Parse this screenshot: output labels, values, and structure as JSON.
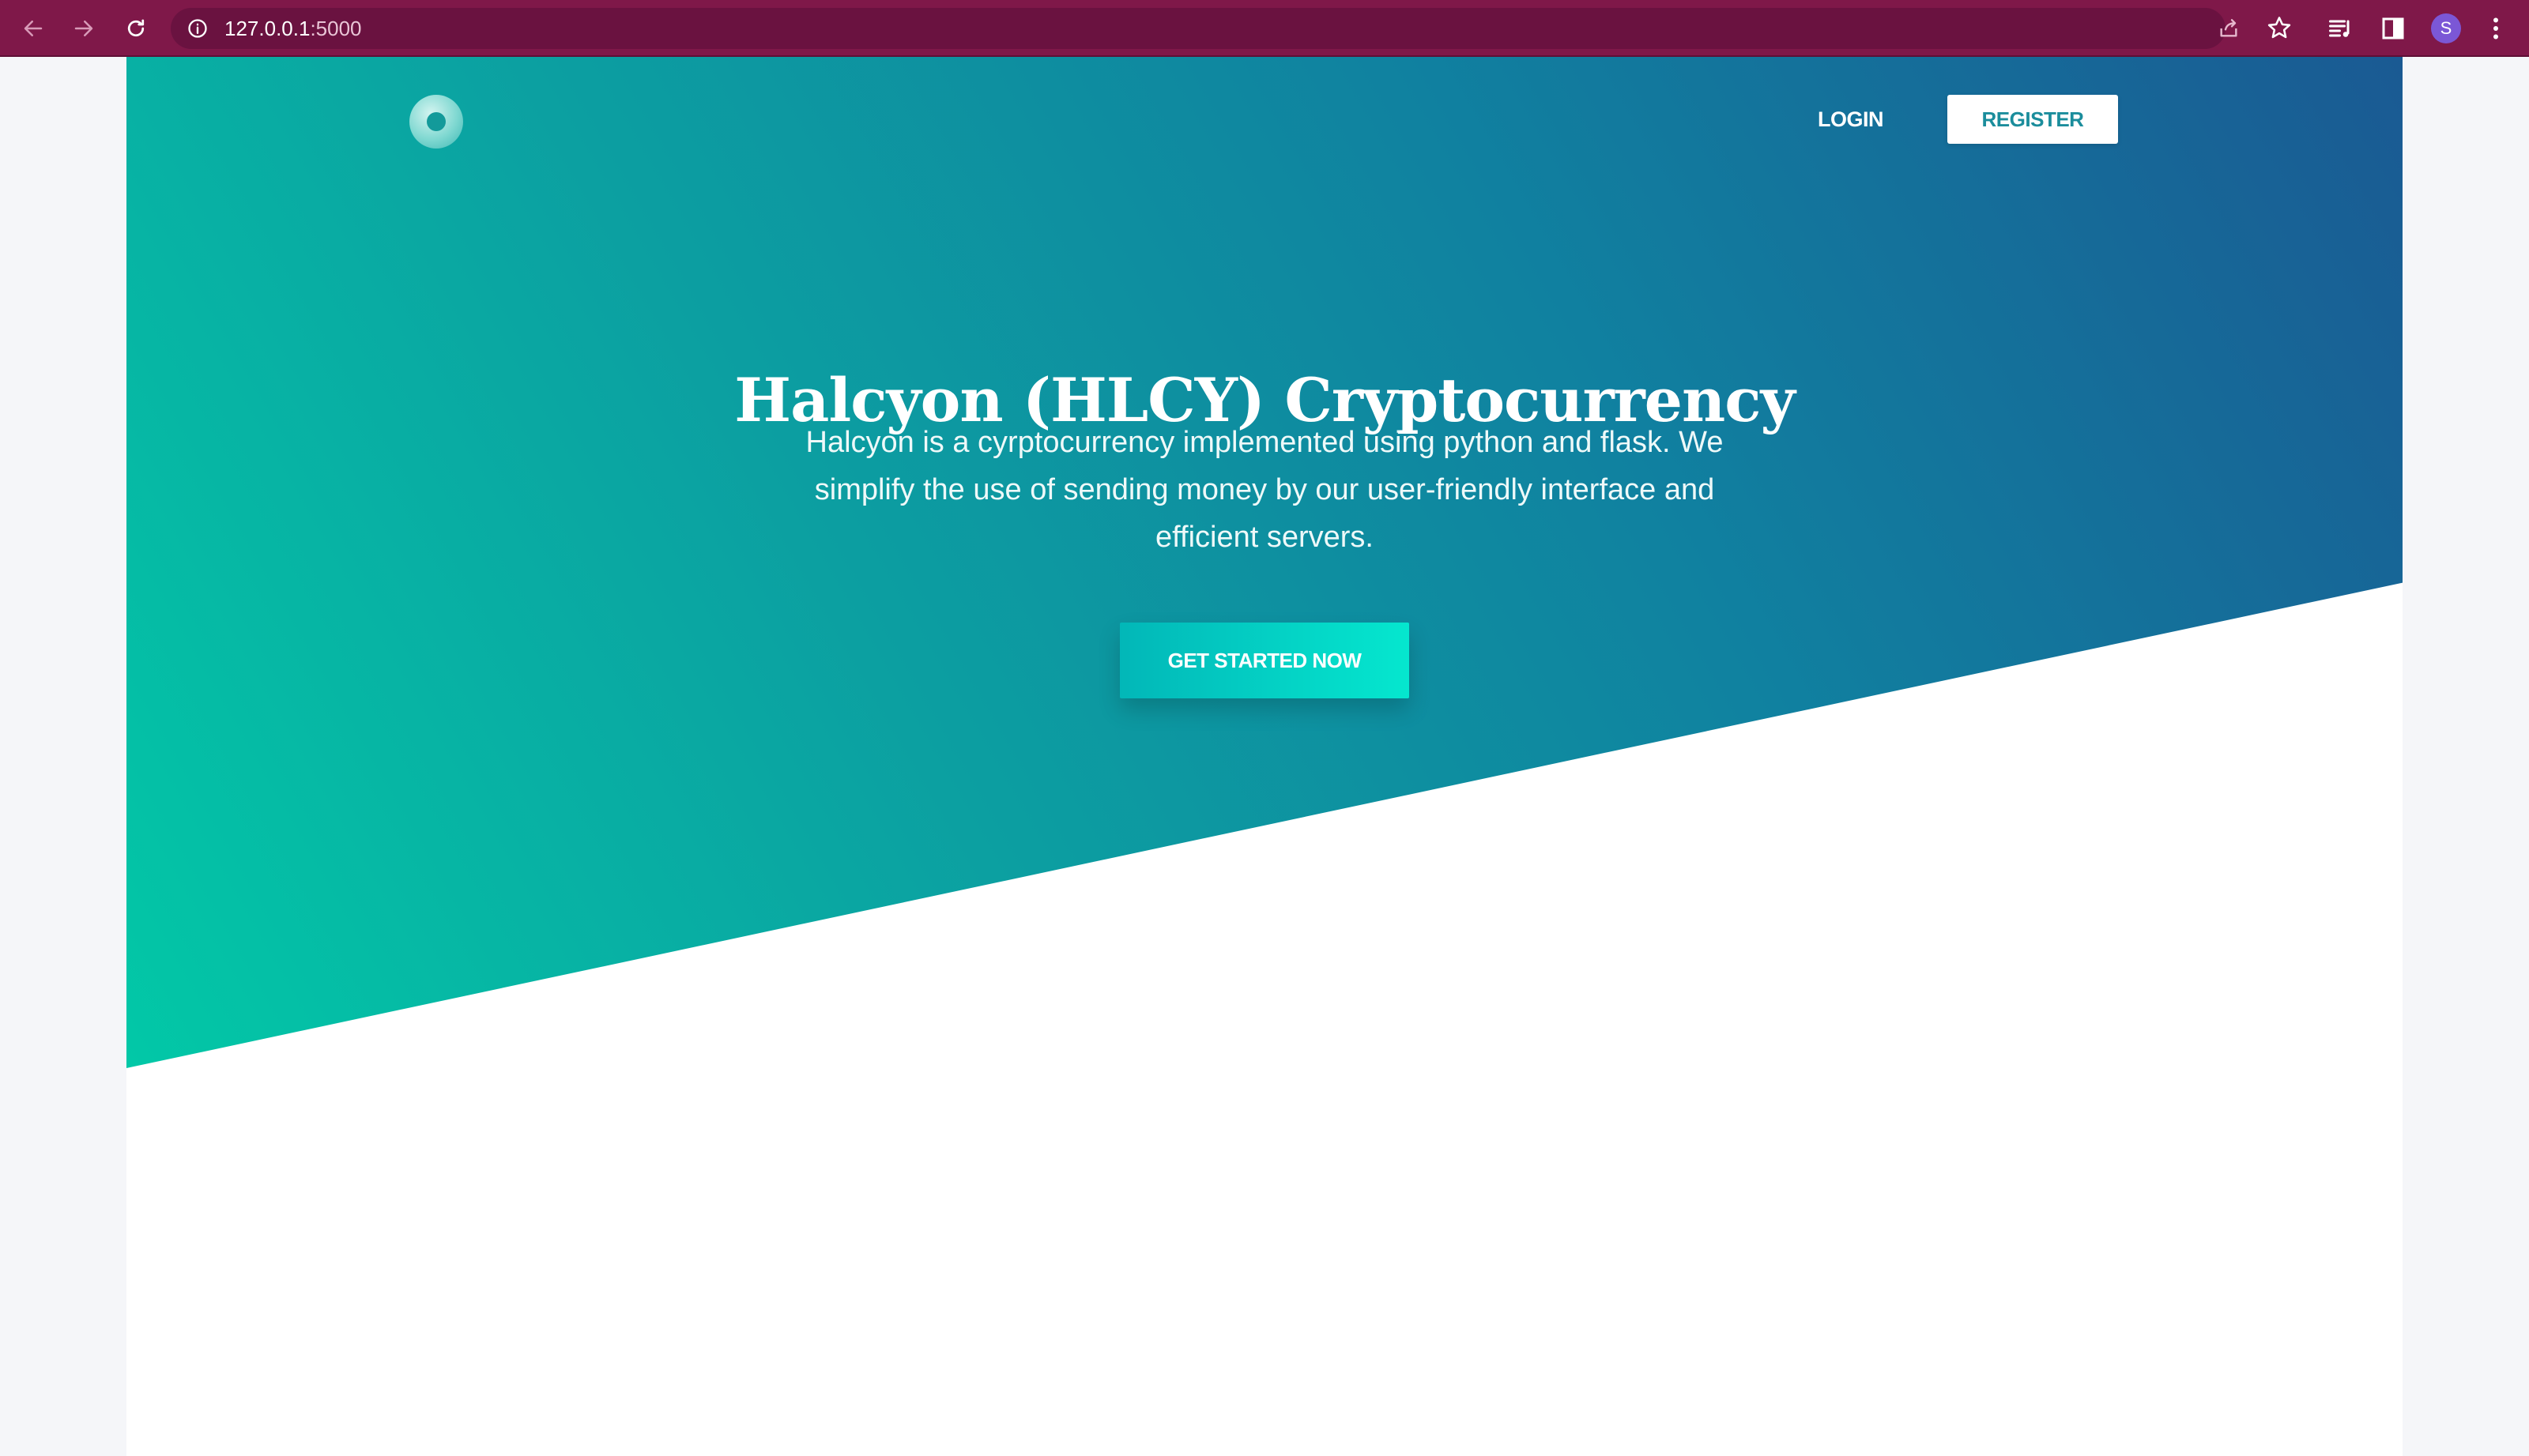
{
  "browser": {
    "url_host": "127.0.0.1",
    "url_port": ":5000",
    "profile_initial": "S"
  },
  "nav": {
    "login_label": "LOGIN",
    "register_label": "REGISTER"
  },
  "hero": {
    "title": "Halcyon (HLCY) Cryptocurrency",
    "subtitle": "Halcyon is a cyrptocurrency implemented using python and flask. We simplify the use of sending money by our user-friendly interface and efficient servers.",
    "cta_label": "GET STARTED NOW"
  },
  "colors": {
    "chrome": "#7f1849",
    "hero_gradient_start": "#02c8a7",
    "hero_gradient_end": "#1a5a93",
    "register_text": "#1b8d9c",
    "cta_gradient_start": "#02b7b8",
    "cta_gradient_end": "#05e7cf"
  }
}
